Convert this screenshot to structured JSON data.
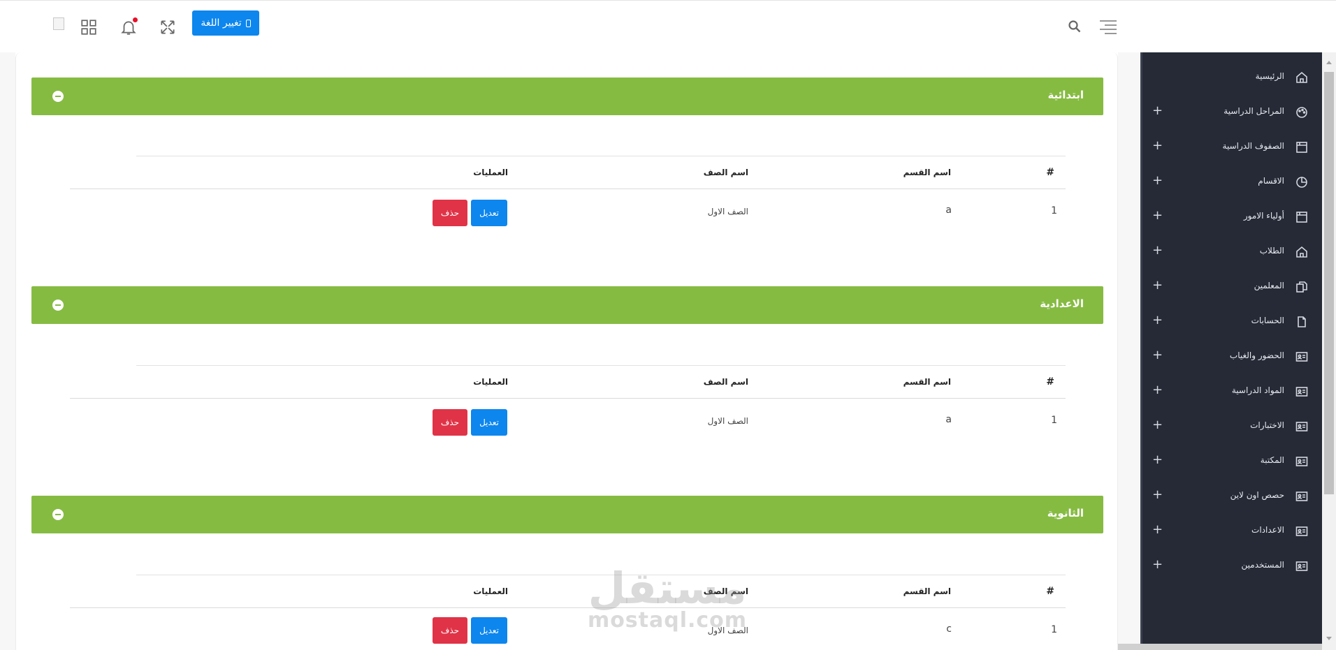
{
  "topbar": {
    "language_button": "تغيير اللغة",
    "icons": [
      "broken-image-icon",
      "grid-icon",
      "bell-icon",
      "fullscreen-icon",
      "search-icon",
      "menu-icon"
    ],
    "notification_dot_color": "#e8102a"
  },
  "sections": [
    {
      "title": "ابتدائية",
      "headers": {
        "num": "#",
        "section": "اسم القسم",
        "class": "اسم الصف",
        "ops": "العمليات"
      },
      "rows": [
        {
          "num": "1",
          "section": "a",
          "class": "الصف الاول",
          "edit": "تعديل",
          "delete": "حذف"
        }
      ]
    },
    {
      "title": "الاعدادية",
      "headers": {
        "num": "#",
        "section": "اسم القسم",
        "class": "اسم الصف",
        "ops": "العمليات"
      },
      "rows": [
        {
          "num": "1",
          "section": "a",
          "class": "الصف الاول",
          "edit": "تعديل",
          "delete": "حذف"
        }
      ]
    },
    {
      "title": "الثانوية",
      "headers": {
        "num": "#",
        "section": "اسم القسم",
        "class": "اسم الصف",
        "ops": "العمليات"
      },
      "rows": [
        {
          "num": "1",
          "section": "c",
          "class": "الصف الاول",
          "edit": "تعديل",
          "delete": "حذف"
        }
      ]
    }
  ],
  "sidebar": {
    "items": [
      {
        "label": "الرئيسية",
        "icon": "home-icon",
        "expandable": false
      },
      {
        "label": "المراحل الدراسية",
        "icon": "palette-icon",
        "expandable": true
      },
      {
        "label": "الصفوف الدراسية",
        "icon": "window-icon",
        "expandable": true
      },
      {
        "label": "الاقسام",
        "icon": "pie-chart-icon",
        "expandable": true
      },
      {
        "label": "أولياء الامور",
        "icon": "window-icon",
        "expandable": true
      },
      {
        "label": "الطلاب",
        "icon": "home-icon",
        "expandable": true
      },
      {
        "label": "المعلمين",
        "icon": "copy-icon",
        "expandable": true
      },
      {
        "label": "الحسابات",
        "icon": "file-icon",
        "expandable": true
      },
      {
        "label": "الحضور والغياب",
        "icon": "id-card-icon",
        "expandable": true
      },
      {
        "label": "المواد الدراسية",
        "icon": "id-card-icon",
        "expandable": true
      },
      {
        "label": "الاختبارات",
        "icon": "id-card-icon",
        "expandable": true
      },
      {
        "label": "المكتبة",
        "icon": "id-card-icon",
        "expandable": true
      },
      {
        "label": "حصص اون لاين",
        "icon": "id-card-icon",
        "expandable": true
      },
      {
        "label": "الاعدادات",
        "icon": "id-card-icon",
        "expandable": true
      },
      {
        "label": "المستخدمين",
        "icon": "id-card-icon",
        "expandable": true
      }
    ]
  },
  "watermark": {
    "arabic": "مستقل",
    "latin": "mostaql.com"
  },
  "colors": {
    "header_green": "#86bb42",
    "sidebar_bg": "#252a36",
    "primary_blue": "#0d86ee",
    "danger_red": "#e03347"
  }
}
